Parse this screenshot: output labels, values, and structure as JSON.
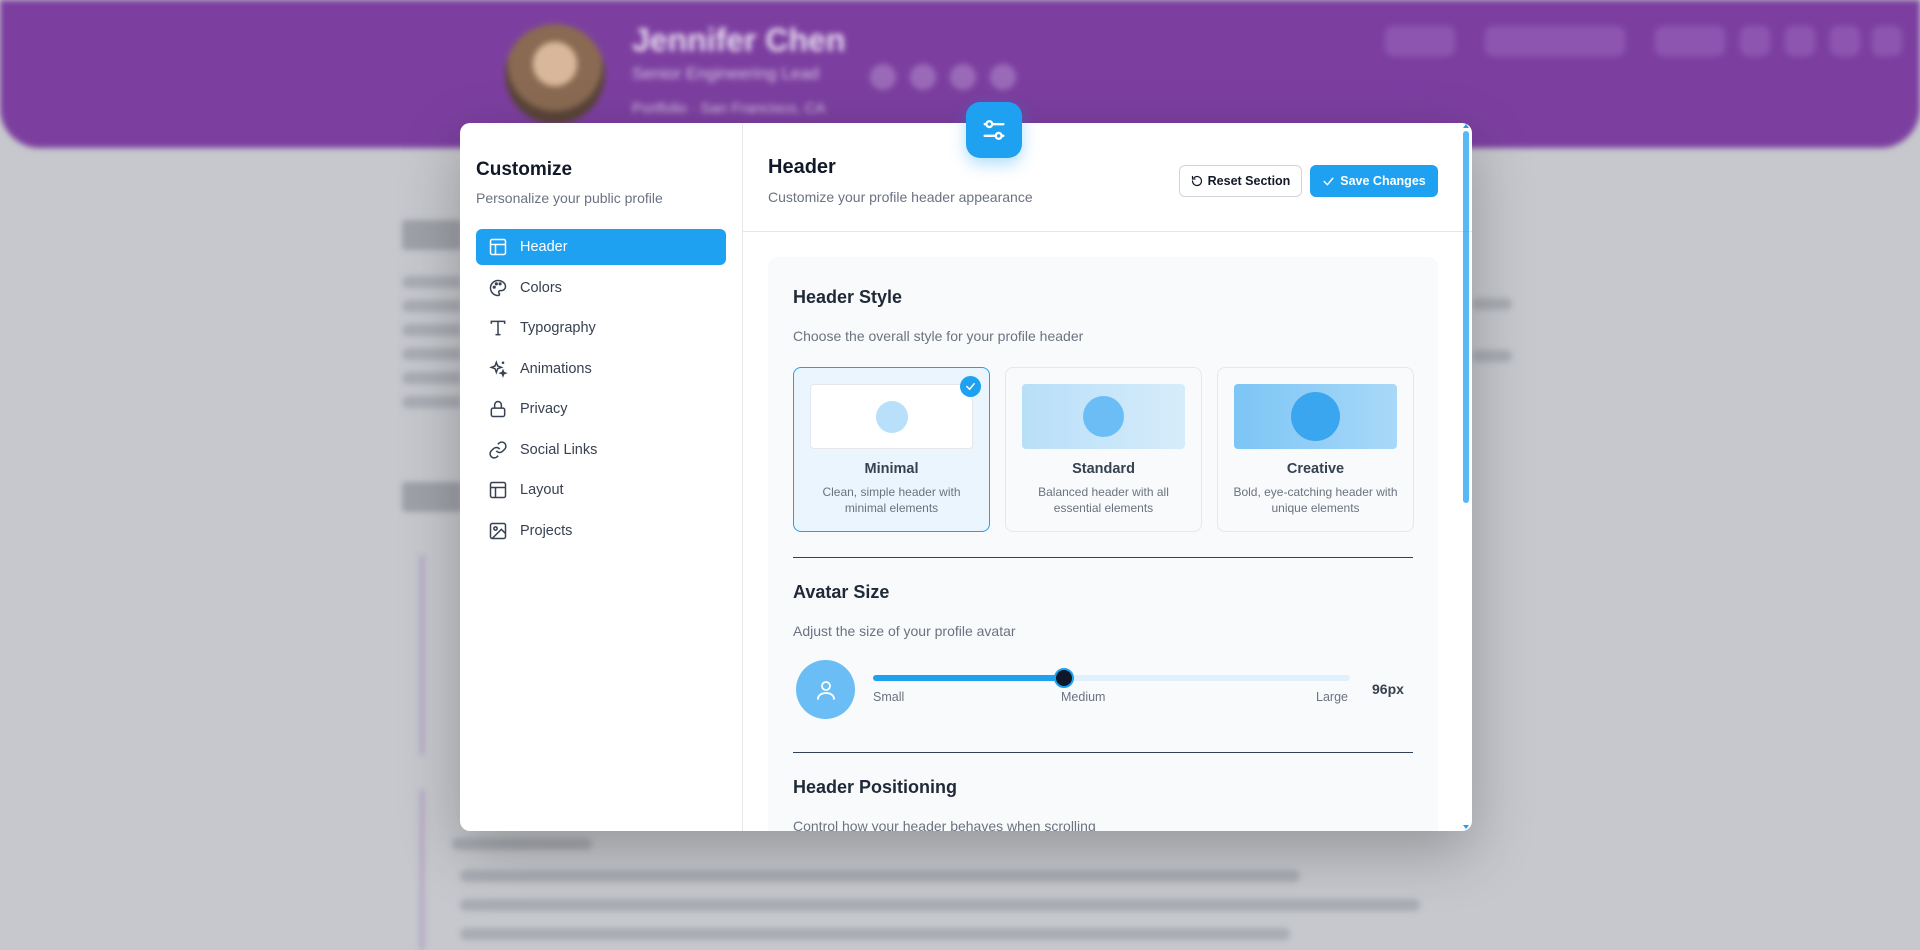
{
  "background": {
    "profile_name": "Jennifer Chen",
    "profile_role": "Senior Engineering Lead",
    "profile_location": "Portfolio · San Francisco, CA"
  },
  "sidebar": {
    "title": "Customize",
    "subtitle": "Personalize your public profile",
    "items": [
      {
        "label": "Header",
        "icon": "layout-icon",
        "active": true
      },
      {
        "label": "Colors",
        "icon": "palette-icon"
      },
      {
        "label": "Typography",
        "icon": "type-icon"
      },
      {
        "label": "Animations",
        "icon": "sparkles-icon"
      },
      {
        "label": "Privacy",
        "icon": "lock-icon"
      },
      {
        "label": "Social Links",
        "icon": "link-icon"
      },
      {
        "label": "Layout",
        "icon": "layout-icon"
      },
      {
        "label": "Projects",
        "icon": "image-icon"
      }
    ]
  },
  "main": {
    "title": "Header",
    "subtitle": "Customize your profile header appearance",
    "reset_label": "Reset Section",
    "save_label": "Save Changes"
  },
  "header_style": {
    "title": "Header Style",
    "description": "Choose the overall style for your profile header",
    "options": [
      {
        "name": "Minimal",
        "description": "Clean, simple header with minimal elements",
        "selected": true
      },
      {
        "name": "Standard",
        "description": "Balanced header with all essential elements",
        "selected": false
      },
      {
        "name": "Creative",
        "description": "Bold, eye-catching header with unique elements",
        "selected": false
      }
    ]
  },
  "avatar_size": {
    "title": "Avatar Size",
    "description": "Adjust the size of your profile avatar",
    "slider_fraction": 0.4,
    "min_label": "Small",
    "mid_label": "Medium",
    "max_label": "Large",
    "value": "96px"
  },
  "header_positioning": {
    "title": "Header Positioning",
    "description": "Control how your header behaves when scrolling"
  },
  "colors": {
    "accent": "#1ea1f1",
    "banner": "#7c3fa0"
  }
}
